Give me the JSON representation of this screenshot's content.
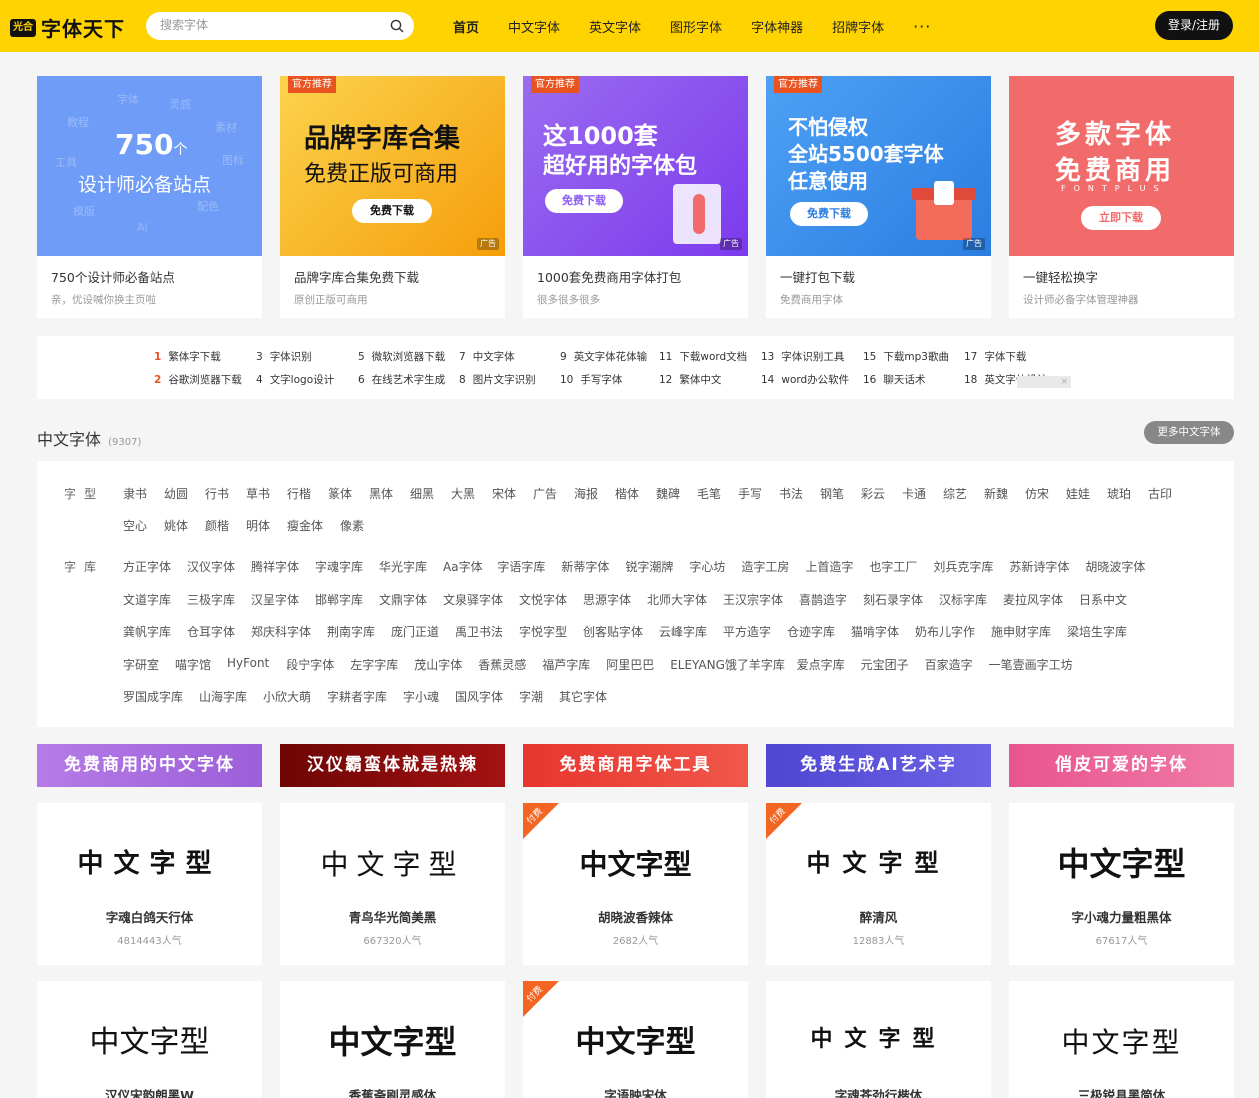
{
  "header": {
    "logo_badge": "光合",
    "logo_text": "字体天下",
    "search_placeholder": "搜索字体",
    "nav": [
      "首页",
      "中文字体",
      "英文字体",
      "图形字体",
      "字体神器",
      "招牌字体"
    ],
    "nav_more": "···",
    "login": "登录/注册",
    "accent": "#ffd300"
  },
  "banners": [
    {
      "big": "750",
      "unit": "个",
      "sub_big": "设计师必备站点",
      "title": "750个设计师必备站点",
      "sub": "亲，优设喊你换主页啦",
      "bg_words": [
        "字体",
        "灵感",
        "教程",
        "素材",
        "工具",
        "图标",
        "模版",
        "配色",
        "AI"
      ],
      "color": "#6e9cf7"
    },
    {
      "tag": "官方推荐",
      "line1": "品牌字库合集",
      "line2": "免费正版可商用",
      "button": "免费下载",
      "ad": "广告",
      "title": "品牌字库合集免费下载",
      "sub": "原创正版可商用",
      "color": "#fbbf24"
    },
    {
      "tag": "官方推荐",
      "line1": "这1000套",
      "line2": "超好用的字体包",
      "button": "免费下载",
      "ad": "广告",
      "title": "1000套免费商用字体打包",
      "sub": "很多很多很多",
      "color": "#8b5cf6"
    },
    {
      "tag": "官方推荐",
      "line1": "不怕侵权",
      "line2": "全站5500套字体",
      "line3": "任意使用",
      "button": "免费下载",
      "ad": "广告",
      "title": "一键打包下载",
      "sub": "免费商用字体",
      "color": "#3b8ef0"
    },
    {
      "line1": "多款字体",
      "line2": "免费商用",
      "brand": "FONTPLUS",
      "button": "立即下载",
      "title": "一键轻松换字",
      "sub": "设计师必备字体管理神器",
      "color": "#f26b6b"
    }
  ],
  "hot_keywords": [
    {
      "num": "1",
      "text": "繁体字下载"
    },
    {
      "num": "2",
      "text": "谷歌浏览器下载"
    },
    {
      "num": "3",
      "text": "字体识别"
    },
    {
      "num": "4",
      "text": "文字logo设计"
    },
    {
      "num": "5",
      "text": "微软浏览器下载"
    },
    {
      "num": "6",
      "text": "在线艺术字生成"
    },
    {
      "num": "7",
      "text": "中文字体"
    },
    {
      "num": "8",
      "text": "图片文字识别"
    },
    {
      "num": "9",
      "text": "英文字体花体输"
    },
    {
      "num": "10",
      "text": "手写字体"
    },
    {
      "num": "11",
      "text": "下载word文档"
    },
    {
      "num": "12",
      "text": "繁体中文"
    },
    {
      "num": "13",
      "text": "字体识别工具"
    },
    {
      "num": "14",
      "text": "word办公软件"
    },
    {
      "num": "15",
      "text": "下载mp3歌曲"
    },
    {
      "num": "16",
      "text": "聊天话术"
    },
    {
      "num": "17",
      "text": "字体下载"
    },
    {
      "num": "18",
      "text": "英文字体设计"
    }
  ],
  "ad_close": "×",
  "section": {
    "title": "中文字体",
    "count": "(9307)",
    "more": "更多中文字体"
  },
  "filters": {
    "type_label": "字型",
    "types_row1": [
      "隶书",
      "幼圆",
      "行书",
      "草书",
      "行楷",
      "篆体",
      "黑体",
      "细黑",
      "大黑",
      "宋体",
      "广告",
      "海报",
      "楷体",
      "魏碑",
      "毛笔",
      "手写",
      "书法",
      "钢笔",
      "彩云",
      "卡通",
      "综艺",
      "新魏",
      "仿宋",
      "娃娃",
      "琥珀",
      "古印"
    ],
    "types_row2": [
      "空心",
      "姚体",
      "颜楷",
      "明体",
      "瘦金体",
      "像素"
    ],
    "lib_label": "字库",
    "libs_row1": [
      "方正字体",
      "汉仪字体",
      "腾祥字体",
      "字魂字库",
      "华光字库",
      "Aa字体",
      "字语字库",
      "新蒂字体",
      "锐字潮牌",
      "字心坊",
      "造字工房",
      "上首造字",
      "也字工厂",
      "刘兵克字库",
      "苏新诗字体",
      "胡晓波字体"
    ],
    "libs_row2": [
      "文道字库",
      "三极字库",
      "汉呈字体",
      "邯郸字库",
      "文鼎字体",
      "文泉驿字体",
      "文悦字体",
      "思源字体",
      "北师大字体",
      "王汉宗字体",
      "喜鹊造字",
      "刻石录字体",
      "汉标字库",
      "麦拉风字体",
      "日系中文"
    ],
    "libs_row3": [
      "龚帆字库",
      "仓耳字体",
      "郑庆科字体",
      "荆南字库",
      "庞门正道",
      "禹卫书法",
      "字悦字型",
      "创客贴字体",
      "云峰字库",
      "平方造字",
      "仓迹字库",
      "猫啃字体",
      "奶布儿字作",
      "施申财字库",
      "梁培生字库"
    ],
    "libs_row4": [
      "字研室",
      "喵字馆",
      "HyFont",
      "段宁字体",
      "左字字库",
      "茂山字体",
      "香蕉灵感",
      "福芦字库",
      "阿里巴巴",
      "ELEYANG饿了羊字库",
      "爱点字库",
      "元宝团子",
      "百家造字",
      "一笔壹画字工坊"
    ],
    "libs_row5": [
      "罗国成字库",
      "山海字库",
      "小欣大萌",
      "字耕者字库",
      "字小魂",
      "国风字体",
      "字潮",
      "其它字体"
    ]
  },
  "category_banners": [
    {
      "text": "免费商用的中文字体",
      "color": "#a66ee0"
    },
    {
      "text": "汉仪霸蛮体就是热辣",
      "color": "#8b0a0a"
    },
    {
      "text": "免费商用字体工具",
      "color": "#e8352f"
    },
    {
      "text": "免费生成AI艺术字",
      "color": "#5b52d6"
    },
    {
      "text": "俏皮可爱的字体",
      "color": "#e8558f"
    }
  ],
  "font_cards": [
    {
      "sample": "中文字型",
      "name": "字魂白鸽天行体",
      "popularity": "4814443人气",
      "paid": false
    },
    {
      "sample": "中文字型",
      "name": "青鸟华光简美黑",
      "popularity": "667320人气",
      "paid": false
    },
    {
      "sample": "中文字型",
      "name": "胡晓波香辣体",
      "popularity": "2682人气",
      "paid": true
    },
    {
      "sample": "中文字型",
      "name": "醉清风",
      "popularity": "12883人气",
      "paid": true
    },
    {
      "sample": "中文字型",
      "name": "字小魂力量粗黑体",
      "popularity": "67617人气",
      "paid": false
    },
    {
      "sample": "中文字型",
      "name": "汉仪宋韵朗黑W",
      "popularity": "",
      "paid": false
    },
    {
      "sample": "中文字型",
      "name": "香蕉斋刷灵感体",
      "popularity": "",
      "paid": false
    },
    {
      "sample": "中文字型",
      "name": "字语映宋体",
      "popularity": "",
      "paid": true
    },
    {
      "sample": "中文字型",
      "name": "字魂苍劲行楷体",
      "popularity": "",
      "paid": false
    },
    {
      "sample": "中文字型",
      "name": "三极锐具黑简体",
      "popularity": "",
      "paid": false
    }
  ],
  "paid_label": "付费"
}
